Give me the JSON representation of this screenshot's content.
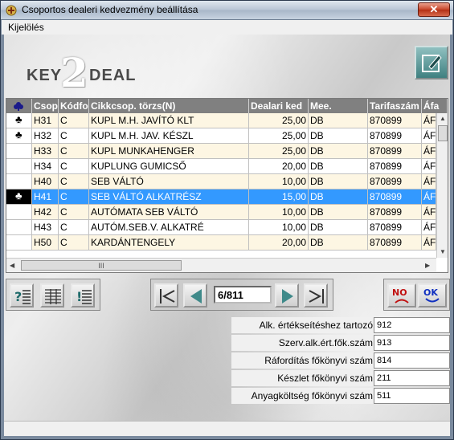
{
  "window": {
    "title": "Csoportos dealeri kedvezmény beállítása",
    "close_label": "✕"
  },
  "menu": {
    "items": [
      {
        "label": "Kijelölés"
      }
    ]
  },
  "logo": {
    "key": "KEY",
    "two": "2",
    "deal": "DEAL"
  },
  "grid": {
    "columns": [
      "Csop",
      "Kódfo",
      "Cikkcsop. törzs(N)",
      "Dealari ked",
      "Mee.",
      "Tarifaszám",
      "Áfa"
    ],
    "rows": [
      {
        "marker": "♣",
        "csop": "H31",
        "kod": "C",
        "torzs": "KUPL M.H. JAVÍTÓ KLT",
        "ked": "25,00",
        "mee": "DB",
        "tarifa": "870899",
        "afa": "ÁF"
      },
      {
        "marker": "♣",
        "csop": "H32",
        "kod": "C",
        "torzs": "KUPL M.H. JAV. KÉSZL",
        "ked": "25,00",
        "mee": "DB",
        "tarifa": "870899",
        "afa": "ÁF"
      },
      {
        "marker": "",
        "csop": "H33",
        "kod": "C",
        "torzs": "KUPL MUNKAHENGER",
        "ked": "25,00",
        "mee": "DB",
        "tarifa": "870899",
        "afa": "ÁF"
      },
      {
        "marker": "",
        "csop": "H34",
        "kod": "C",
        "torzs": "KUPLUNG GUMICSŐ",
        "ked": "20,00",
        "mee": "DB",
        "tarifa": "870899",
        "afa": "ÁF"
      },
      {
        "marker": "",
        "csop": "H40",
        "kod": "C",
        "torzs": "SEB VÁLTÓ",
        "ked": "10,00",
        "mee": "DB",
        "tarifa": "870899",
        "afa": "ÁF"
      },
      {
        "marker": "♣",
        "csop": "H41",
        "kod": "C",
        "torzs": "SEB VÁLTÓ ALKATRÉSZ",
        "ked": "15,00",
        "mee": "DB",
        "tarifa": "870899",
        "afa": "ÁF",
        "selected": true
      },
      {
        "marker": "",
        "csop": "H42",
        "kod": "C",
        "torzs": "AUTÓMATA SEB VÁLTÓ",
        "ked": "10,00",
        "mee": "DB",
        "tarifa": "870899",
        "afa": "ÁF"
      },
      {
        "marker": "",
        "csop": "H43",
        "kod": "C",
        "torzs": "AUTÓM.SEB.V. ALKATRÉ",
        "ked": "10,00",
        "mee": "DB",
        "tarifa": "870899",
        "afa": "ÁF"
      },
      {
        "marker": "",
        "csop": "H50",
        "kod": "C",
        "torzs": "KARDÁNTENGELY",
        "ked": "20,00",
        "mee": "DB",
        "tarifa": "870899",
        "afa": "ÁF"
      }
    ],
    "scroll_thumb": "III"
  },
  "navigator": {
    "position": "6/811"
  },
  "buttons": {
    "no": "NO",
    "ok": "OK"
  },
  "accounts": [
    {
      "label": "Alk. értékseítéshez tartozó",
      "value": "912"
    },
    {
      "label": "Szerv.alk.ért.fők.szám",
      "value": "913"
    },
    {
      "label": "Ráfordítás főkönyvi szám",
      "value": "814"
    },
    {
      "label": "Készlet főkönyvi szám",
      "value": "211"
    },
    {
      "label": "Anyagköltség főkönyvi szám",
      "value": "511"
    }
  ],
  "colors": {
    "selection": "#3399ff",
    "header": "#808080",
    "alt_row": "#fdf6e3",
    "accent_teal": "#3f8080"
  }
}
